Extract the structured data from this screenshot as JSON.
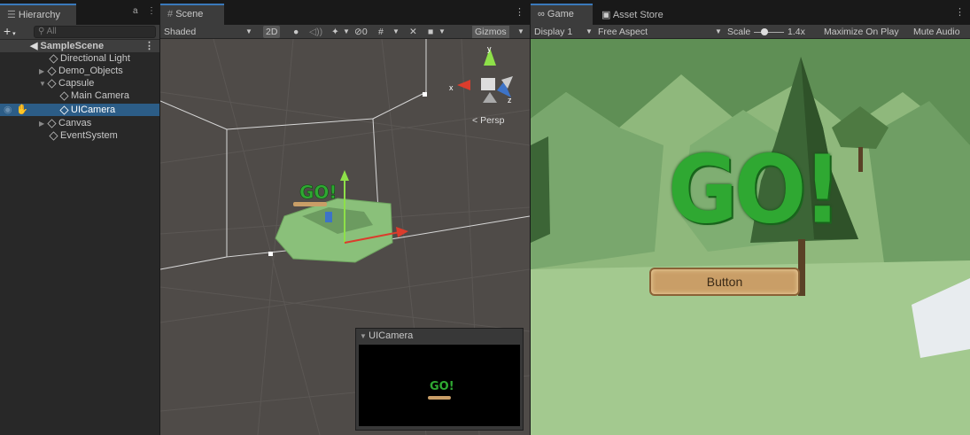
{
  "hierarchy": {
    "tab_label": "Hierarchy",
    "add_label": "+",
    "search_placeholder": "All",
    "items": [
      {
        "label": "SampleScene"
      },
      {
        "label": "Directional Light"
      },
      {
        "label": "Demo_Objects"
      },
      {
        "label": "Capsule"
      },
      {
        "label": "Main Camera"
      },
      {
        "label": "UICamera"
      },
      {
        "label": "Canvas"
      },
      {
        "label": "EventSystem"
      }
    ]
  },
  "scene": {
    "tab_label": "Scene",
    "toolbar": {
      "draw_mode": "Shaded",
      "mode_2d": "2D",
      "hidden_count": "0",
      "gizmos": "Gizmos"
    },
    "persp_label": "Persp",
    "axis_labels": {
      "x": "x",
      "y": "y",
      "z": "z"
    },
    "go_label": "GO!",
    "camera_preview": {
      "title": "UICamera",
      "go_label": "GO!"
    }
  },
  "game": {
    "tab_label": "Game",
    "asset_store_label": "Asset Store",
    "display": "Display 1",
    "aspect": "Free Aspect",
    "scale_label": "Scale",
    "scale_value": "1.4x",
    "maximize_label": "Maximize On Play",
    "mute_label": "Mute Audio",
    "go_label": "GO!",
    "button_label": "Button"
  },
  "colors": {
    "selection": "#2c5d87",
    "tab_accent": "#3a79bb",
    "go_green": "#2fa832"
  }
}
